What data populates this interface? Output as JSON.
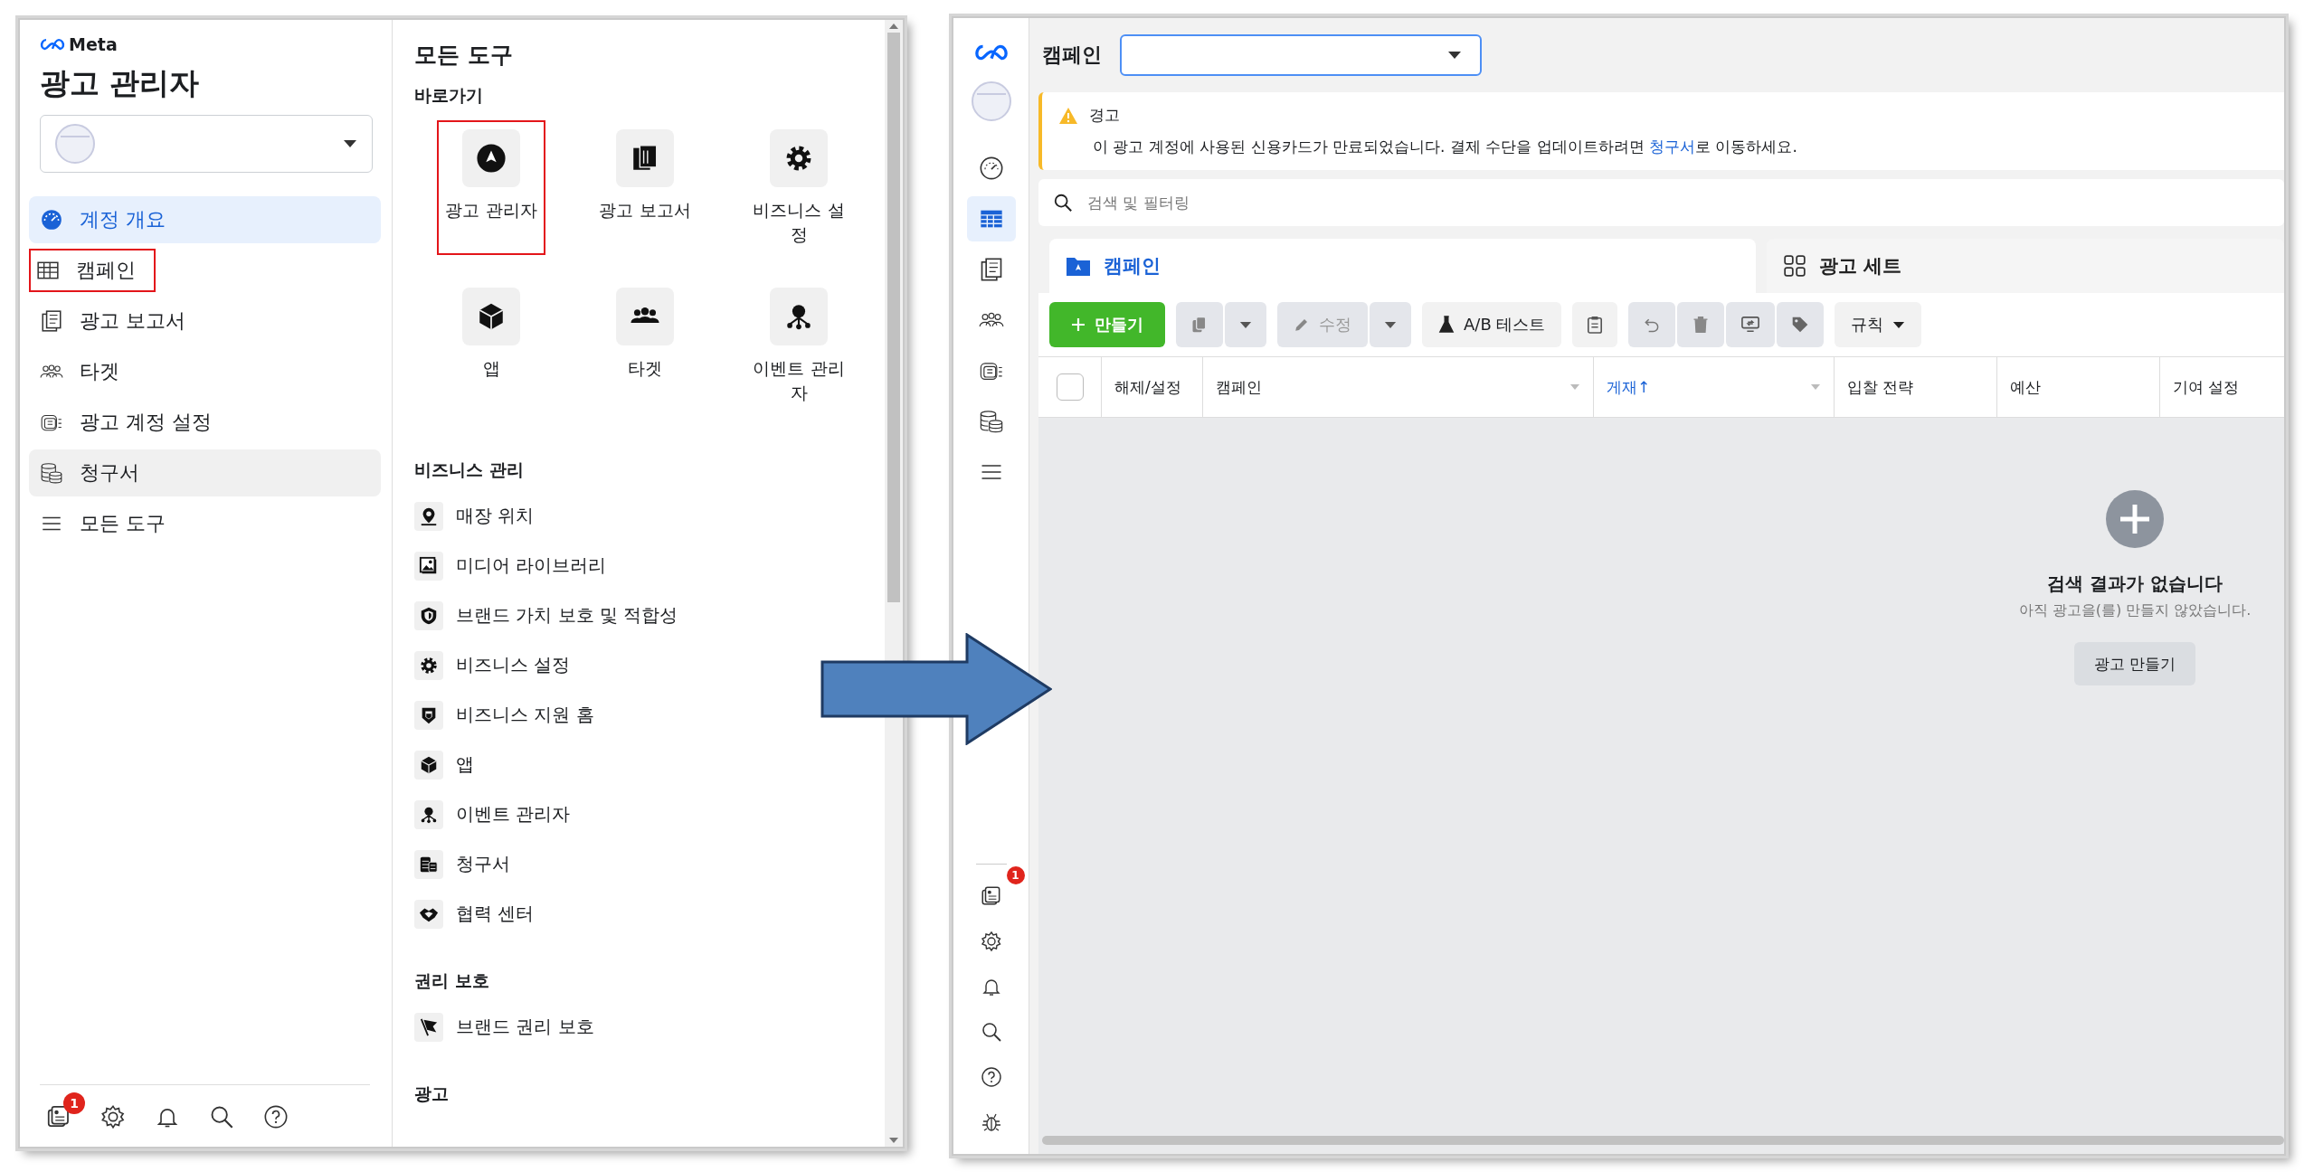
{
  "left_screen": {
    "brand": "Meta",
    "title": "광고 관리자",
    "nav": [
      {
        "label": "계정 개요",
        "selected": true,
        "hovered": false,
        "highlighted": false
      },
      {
        "label": "캠페인",
        "selected": false,
        "hovered": false,
        "highlighted": true
      },
      {
        "label": "광고 보고서",
        "selected": false,
        "hovered": false,
        "highlighted": false
      },
      {
        "label": "타겟",
        "selected": false,
        "hovered": false,
        "highlighted": false
      },
      {
        "label": "광고 계정 설정",
        "selected": false,
        "hovered": false,
        "highlighted": false
      },
      {
        "label": "청구서",
        "selected": false,
        "hovered": true,
        "highlighted": false
      },
      {
        "label": "모든 도구",
        "selected": false,
        "hovered": false,
        "highlighted": false
      }
    ],
    "notification_badge": "1",
    "tools": {
      "title": "모든 도구",
      "shortcuts_heading": "바로가기",
      "shortcuts": [
        {
          "label": "광고 관리자",
          "highlighted": true
        },
        {
          "label": "광고 보고서",
          "highlighted": false
        },
        {
          "label": "비즈니스 설정",
          "highlighted": false
        },
        {
          "label": "앱",
          "highlighted": false
        },
        {
          "label": "타겟",
          "highlighted": false
        },
        {
          "label": "이벤트 관리자",
          "highlighted": false
        }
      ],
      "sections": [
        {
          "heading": "비즈니스 관리",
          "items": [
            "매장 위치",
            "미디어 라이브러리",
            "브랜드 가치 보호 및 적합성",
            "비즈니스 설정",
            "비즈니스 지원 홈",
            "앱",
            "이벤트 관리자",
            "청구서",
            "협력 센터"
          ]
        },
        {
          "heading": "권리 보호",
          "items": [
            "브랜드 권리 보호"
          ]
        },
        {
          "heading": "광고"
        }
      ]
    }
  },
  "right_screen": {
    "header_label": "캠페인",
    "rail_items": [
      {
        "selected": false
      },
      {
        "selected": true
      },
      {
        "selected": false
      },
      {
        "selected": false
      },
      {
        "selected": false
      },
      {
        "selected": false
      },
      {
        "selected": false
      }
    ],
    "notification_badge": "1",
    "warning": {
      "title": "경고",
      "text_before": "이 광고 계정에 사용된 신용카드가 만료되었습니다. 결제 수단을 업데이트하려면 ",
      "link": "청구서",
      "text_after": "로 이동하세요."
    },
    "search": {
      "placeholder": "검색 및 필터링"
    },
    "tabs": [
      {
        "label": "캠페인",
        "selected": true
      },
      {
        "label": "광고 세트",
        "selected": false
      }
    ],
    "toolbar": {
      "create": "만들기",
      "edit": {
        "label": "수정",
        "disabled": true
      },
      "ab_test": "A/B 테스트",
      "rules": "규칙"
    },
    "table": {
      "select_all_checked": false,
      "columns": [
        {
          "label": "해제/설정",
          "sorted": false
        },
        {
          "label": "캠페인",
          "sorted": false
        },
        {
          "label": "게재↑",
          "sorted": true
        },
        {
          "label": "입찰 전략",
          "sorted": false
        },
        {
          "label": "예산",
          "sorted": false
        },
        {
          "label": "기여 설정",
          "sorted": false
        }
      ]
    },
    "empty_state": {
      "title": "검색 결과가 없습니다",
      "message": "아직 광고을(를) 만들지 않았습니다.",
      "button": "광고 만들기"
    }
  }
}
